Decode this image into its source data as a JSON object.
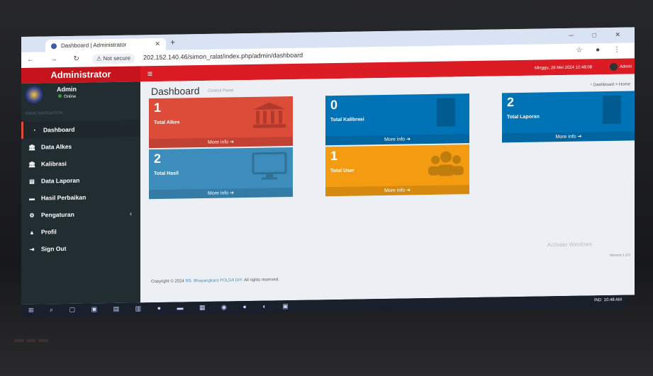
{
  "browser": {
    "tab_title": "Dashboard | Administrator",
    "security_label": "Not secure",
    "url": "202.152.140.46/simon_ralat/index.php/admin/dashboard"
  },
  "header": {
    "logo": "Administrator",
    "datetime": "Minggu, 26 Mei 2024 10:48:08",
    "user_label": "Admin"
  },
  "sidebar": {
    "user_name": "Admin",
    "user_status": "Online",
    "section_label": "MAIN NAVIGATION",
    "items": [
      {
        "label": "Dashboard",
        "icon": "dashboard-icon",
        "active": true
      },
      {
        "label": "Data Alkes",
        "icon": "bank-icon"
      },
      {
        "label": "Kalibrasi",
        "icon": "bank-icon"
      },
      {
        "label": "Data Laporan",
        "icon": "book-icon"
      },
      {
        "label": "Hasil Perbaikan",
        "icon": "car-icon"
      },
      {
        "label": "Pengaturan",
        "icon": "cogs-icon",
        "has_submenu": true
      },
      {
        "label": "Profil",
        "icon": "user-icon"
      },
      {
        "label": "Sign Out",
        "icon": "sign-out-icon"
      }
    ]
  },
  "content": {
    "title": "Dashboard",
    "subtitle": "Control Panel",
    "breadcrumb_home": "Dashboard",
    "breadcrumb_sep": ">",
    "breadcrumb_current": "Home",
    "boxes": [
      {
        "value": "1",
        "label": "Total Alkes",
        "more": "More info ➔",
        "color": "#dd4b39"
      },
      {
        "value": "0",
        "label": "Total Kalibrasi",
        "more": "More info ➔",
        "color": "#0073b7"
      },
      {
        "value": "2",
        "label": "Total Laporan",
        "more": "More info ➔",
        "color": "#0073b7"
      },
      {
        "value": "2",
        "label": "Total Hasil",
        "more": "More info ➔",
        "color": "#3c8dbc"
      },
      {
        "value": "1",
        "label": "Total User",
        "more": "More info ➔",
        "color": "#f39c12"
      }
    ],
    "footer_prefix": "Copyright © 2024",
    "footer_link": "RS. Bhayangkara POLDA DIY.",
    "footer_suffix": "All rights reserved.",
    "watermark": "Activate Windows",
    "version": "Version 1.0.0"
  },
  "taskbar": {
    "language": "IND",
    "time": "10:48 AM"
  }
}
